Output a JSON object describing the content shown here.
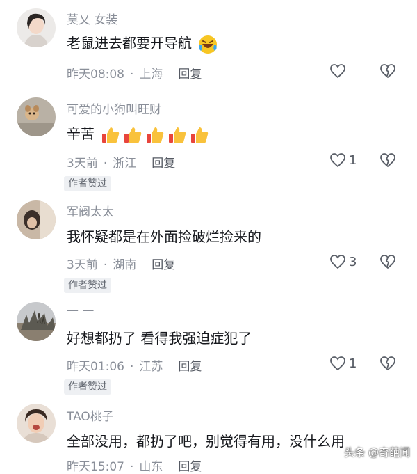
{
  "comments": [
    {
      "user": "莫乂 女装",
      "text": "老鼠进去都要开导航",
      "emoji": [
        "laughing-crying-emoji"
      ],
      "time": "昨天08:08",
      "location": "上海",
      "reply_label": "回复",
      "likes": "",
      "author_liked": ""
    },
    {
      "user": "可爱的小狗叫旺财",
      "text": "辛苦",
      "emoji": [
        "thumbs-up-emoji",
        "thumbs-up-emoji",
        "thumbs-up-emoji",
        "thumbs-up-emoji",
        "thumbs-up-emoji"
      ],
      "time": "3天前",
      "location": "浙江",
      "reply_label": "回复",
      "likes": "1",
      "author_liked": "作者赞过"
    },
    {
      "user": "军阀太太",
      "text": "我怀疑都是在外面捡破烂捡来的",
      "emoji": [],
      "time": "3天前",
      "location": "湖南",
      "reply_label": "回复",
      "likes": "3",
      "author_liked": "作者赞过"
    },
    {
      "user": "— —",
      "text": "好想都扔了 看得我强迫症犯了",
      "emoji": [],
      "time": "昨天01:06",
      "location": "江苏",
      "reply_label": "回复",
      "likes": "1",
      "author_liked": "作者赞过"
    },
    {
      "user": "TAO桃子",
      "text": "全部没用，都扔了吧，别觉得有用，没什么用",
      "emoji": [],
      "time": "昨天15:07",
      "location": "山东",
      "reply_label": "回复",
      "likes": "",
      "author_liked": ""
    }
  ],
  "watermark": "头条 @奇葩闻",
  "colors": {
    "username": "#8a8f99",
    "text": "#16181d",
    "badge_bg": "#eef0f3"
  }
}
